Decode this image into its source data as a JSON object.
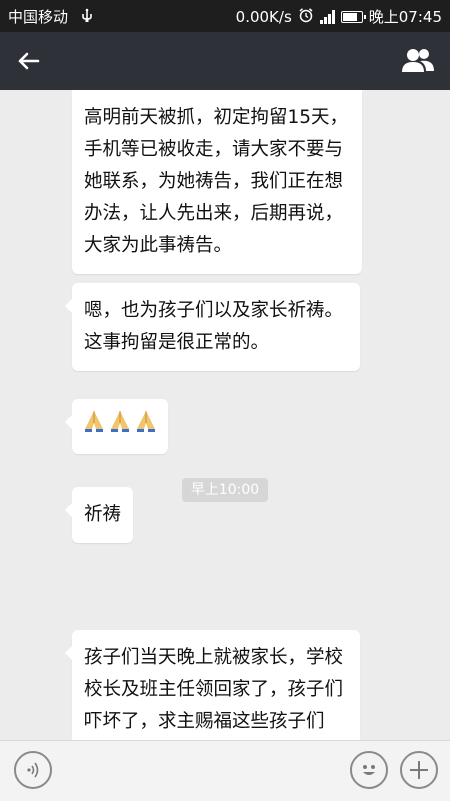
{
  "status_bar": {
    "carrier": "中国移动",
    "network_speed": "0.00K/s",
    "time": "晚上07:45",
    "battery_level": 0.8,
    "icons": [
      "usb-icon",
      "alarm-icon",
      "signal-icon",
      "battery-icon"
    ]
  },
  "title_bar": {
    "icons": [
      "back-arrow-icon",
      "group-contacts-icon"
    ]
  },
  "messages": [
    {
      "text": "高明前天被抓，初定拘留15天，手机等已被收走，请大家不要与她联系，为她祷告，我们正在想办法，让人先出来，后期再说，大家为此事祷告。"
    },
    {
      "text": "嗯，也为孩子们以及家长祈祷。这事拘留是很正常的。"
    },
    {
      "emoji": "praying-hands-icon",
      "count": 3
    },
    {
      "text": "祈祷"
    },
    {
      "text": "孩子们当天晚上就被家长，学校校长及班主任领回家了，孩子们吓坏了，求主赐福这些孩子们"
    }
  ],
  "timestamp": "早上10:00",
  "input_bar": {
    "icons": [
      "voice-icon",
      "emoji-smile-icon",
      "plus-icon"
    ]
  },
  "colors": {
    "status_bar_bg": "#1e1e1e",
    "title_bar_bg": "#2e3238",
    "chat_bg": "#ececec",
    "bubble_bg": "#ffffff",
    "timestamp_bg": "#d6d6d6"
  }
}
